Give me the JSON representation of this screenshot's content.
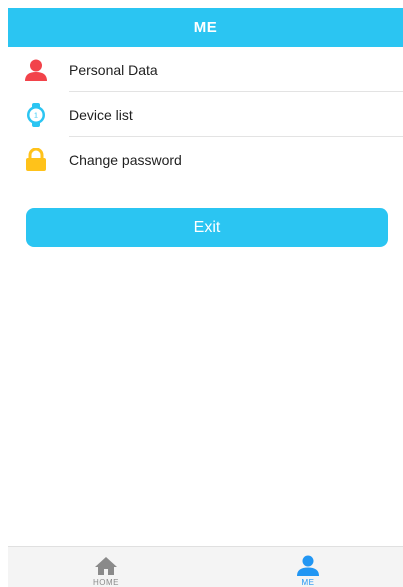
{
  "header": {
    "title": "ME"
  },
  "menu": {
    "items": [
      {
        "label": "Personal Data",
        "icon": "person-icon",
        "color": "#f2434a"
      },
      {
        "label": "Device list",
        "icon": "watch-icon",
        "color": "#2bc5f2"
      },
      {
        "label": "Change password",
        "icon": "lock-icon",
        "color": "#ffc21a"
      }
    ]
  },
  "exit": {
    "label": "Exit"
  },
  "tabbar": {
    "items": [
      {
        "label": "HOME",
        "icon": "home-icon",
        "color": "#8a8a8a",
        "active": false
      },
      {
        "label": "ME",
        "icon": "user-icon",
        "color": "#2196f3",
        "active": true
      }
    ]
  },
  "colors": {
    "accent": "#2bc5f2"
  }
}
